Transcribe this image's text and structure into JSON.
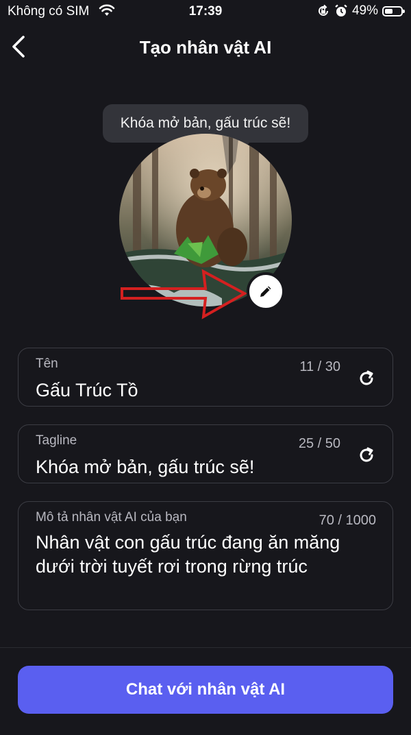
{
  "status_bar": {
    "carrier": "Không có SIM",
    "time": "17:39",
    "battery_percent": "49%",
    "battery_level": 0.49
  },
  "header": {
    "title": "Tạo nhân vật AI",
    "back_icon": "chevron-left-icon"
  },
  "avatar": {
    "bubble_text": "Khóa mở bản, gấu trúc sẽ!",
    "edit_icon": "pencil-icon",
    "annotation_color": "#d42020"
  },
  "fields": {
    "name": {
      "label": "Tên",
      "count": "11 / 30",
      "value": "Gấu Trúc Tồ",
      "icon": "refresh-icon"
    },
    "tagline": {
      "label": "Tagline",
      "count": "25 / 50",
      "value": "Khóa mở bản, gấu trúc sẽ!",
      "icon": "refresh-icon"
    },
    "description": {
      "label": "Mô tả nhân vật AI của bạn",
      "count": "70 / 1000",
      "value": "Nhân vật con gấu trúc đang ăn măng dưới trời tuyết rơi trong rừng trúc"
    }
  },
  "cta": {
    "label": "Chat với nhân vật AI",
    "color": "#5a5ff0"
  },
  "colors": {
    "background": "#17171c",
    "field_border": "#3c3d44"
  }
}
